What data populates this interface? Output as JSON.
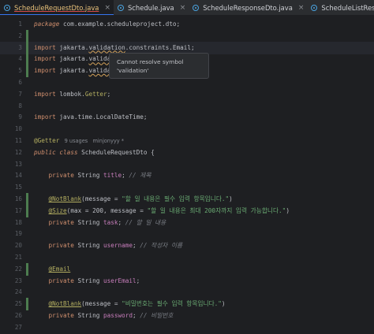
{
  "tabs": [
    {
      "label": "ScheduleRequestDto.java",
      "active": true
    },
    {
      "label": "Schedule.java",
      "active": false
    },
    {
      "label": "ScheduleResponseDto.java",
      "active": false
    },
    {
      "label": "ScheduleListResponseDto.java",
      "active": false
    }
  ],
  "close_glyph": "×",
  "tooltip": {
    "line1": "Cannot resolve symbol",
    "line2": "'validation'"
  },
  "lines": [
    {
      "n": "1",
      "mark": false,
      "tokens": [
        [
          "kwi",
          "package"
        ],
        [
          "",
          " com.example.scheduleproject.dto;"
        ]
      ]
    },
    {
      "n": "2",
      "mark": true,
      "tokens": []
    },
    {
      "n": "3",
      "mark": true,
      "cur": true,
      "tokens": [
        [
          "kw",
          "import"
        ],
        [
          "",
          " jakarta."
        ],
        [
          "err",
          "validation"
        ],
        [
          "",
          ".constraints.Email;"
        ]
      ]
    },
    {
      "n": "4",
      "mark": true,
      "tokens": [
        [
          "kw",
          "import"
        ],
        [
          "",
          " jakarta."
        ],
        [
          "err",
          "validat"
        ]
      ]
    },
    {
      "n": "5",
      "mark": true,
      "tokens": [
        [
          "kw",
          "import"
        ],
        [
          "",
          " jakarta."
        ],
        [
          "err",
          "validat"
        ]
      ]
    },
    {
      "n": "6",
      "mark": false,
      "tokens": []
    },
    {
      "n": "7",
      "mark": false,
      "tokens": [
        [
          "kw",
          "import"
        ],
        [
          "",
          " lombok."
        ],
        [
          "ann",
          "Getter"
        ],
        [
          "",
          ";"
        ]
      ]
    },
    {
      "n": "8",
      "mark": false,
      "tokens": []
    },
    {
      "n": "9",
      "mark": false,
      "tokens": [
        [
          "kw",
          "import"
        ],
        [
          "",
          " java.time.LocalDateTime;"
        ]
      ]
    },
    {
      "n": "10",
      "mark": false,
      "tokens": []
    },
    {
      "n": "11",
      "mark": false,
      "tokens": [
        [
          "ann",
          "@Getter"
        ],
        [
          "hint",
          "  9 usages   minjonyyy *"
        ]
      ]
    },
    {
      "n": "12",
      "mark": false,
      "tokens": [
        [
          "kwi",
          "public class"
        ],
        [
          "",
          " ScheduleRequestDto {"
        ]
      ]
    },
    {
      "n": "13",
      "mark": false,
      "tokens": []
    },
    {
      "n": "14",
      "mark": false,
      "tokens": [
        [
          "",
          "    "
        ],
        [
          "kw",
          "private"
        ],
        [
          "",
          " String "
        ],
        [
          "fld",
          "title"
        ],
        [
          "",
          "; "
        ],
        [
          "cm",
          "// 제목"
        ]
      ]
    },
    {
      "n": "15",
      "mark": false,
      "tokens": []
    },
    {
      "n": "16",
      "mark": true,
      "tokens": [
        [
          "",
          "    "
        ],
        [
          "ann2",
          "@NotBlank"
        ],
        [
          "",
          "("
        ],
        [
          "param",
          "message"
        ],
        [
          "",
          " = "
        ],
        [
          "str",
          "\"할 일 내용은 필수 입력 항목입니다.\""
        ],
        [
          "",
          ")"
        ]
      ]
    },
    {
      "n": "17",
      "mark": true,
      "tokens": [
        [
          "",
          "    "
        ],
        [
          "ann2",
          "@Size"
        ],
        [
          "",
          "("
        ],
        [
          "param",
          "max"
        ],
        [
          "",
          " = 200, "
        ],
        [
          "param",
          "message"
        ],
        [
          "",
          " = "
        ],
        [
          "str",
          "\"할 일 내용은 최대 200자까지 입력 가능합니다.\""
        ],
        [
          "",
          ")"
        ]
      ]
    },
    {
      "n": "18",
      "mark": false,
      "tokens": [
        [
          "",
          "    "
        ],
        [
          "kw",
          "private"
        ],
        [
          "",
          " String "
        ],
        [
          "fld",
          "task"
        ],
        [
          "",
          "; "
        ],
        [
          "cm",
          "// 할 일 내용"
        ]
      ]
    },
    {
      "n": "19",
      "mark": false,
      "tokens": []
    },
    {
      "n": "20",
      "mark": false,
      "tokens": [
        [
          "",
          "    "
        ],
        [
          "kw",
          "private"
        ],
        [
          "",
          " String "
        ],
        [
          "fld",
          "username"
        ],
        [
          "",
          "; "
        ],
        [
          "cm",
          "// 작성자 이름"
        ]
      ]
    },
    {
      "n": "21",
      "mark": false,
      "tokens": []
    },
    {
      "n": "22",
      "mark": true,
      "tokens": [
        [
          "",
          "    "
        ],
        [
          "ann2",
          "@Email"
        ]
      ]
    },
    {
      "n": "23",
      "mark": false,
      "tokens": [
        [
          "",
          "    "
        ],
        [
          "kw",
          "private"
        ],
        [
          "",
          " String "
        ],
        [
          "fld",
          "userEmail"
        ],
        [
          "",
          ";"
        ]
      ]
    },
    {
      "n": "24",
      "mark": false,
      "tokens": []
    },
    {
      "n": "25",
      "mark": true,
      "tokens": [
        [
          "",
          "    "
        ],
        [
          "ann2",
          "@NotBlank"
        ],
        [
          "",
          "("
        ],
        [
          "param",
          "message"
        ],
        [
          "",
          " = "
        ],
        [
          "str",
          "\"비밀번호는 필수 입력 항목입니다.\""
        ],
        [
          "",
          ")"
        ]
      ]
    },
    {
      "n": "26",
      "mark": false,
      "tokens": [
        [
          "",
          "    "
        ],
        [
          "kw",
          "private"
        ],
        [
          "",
          " String "
        ],
        [
          "fld",
          "password"
        ],
        [
          "",
          "; "
        ],
        [
          "cm",
          "// 비밀번호"
        ]
      ]
    },
    {
      "n": "27",
      "mark": false,
      "tokens": []
    }
  ]
}
